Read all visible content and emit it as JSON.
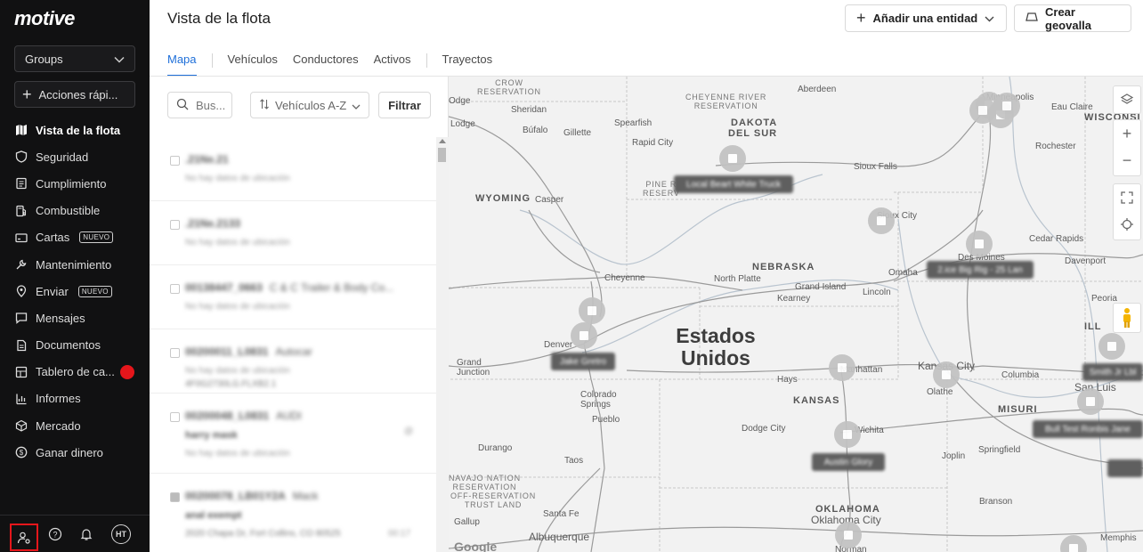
{
  "sidebar": {
    "logo": "motive",
    "groups_label": "Groups",
    "quick_actions_label": "Acciones rápi...",
    "items": [
      {
        "label": "Vista de la flota",
        "icon": "map-icon",
        "active": true
      },
      {
        "label": "Seguridad",
        "icon": "shield-icon"
      },
      {
        "label": "Cumplimiento",
        "icon": "clipboard-icon"
      },
      {
        "label": "Combustible",
        "icon": "fuel-icon"
      },
      {
        "label": "Cartas",
        "icon": "card-icon",
        "badge": "NUEVO"
      },
      {
        "label": "Mantenimiento",
        "icon": "wrench-icon"
      },
      {
        "label": "Enviar",
        "icon": "location-pin-icon",
        "badge": "NUEVO"
      },
      {
        "label": "Mensajes",
        "icon": "chat-icon"
      },
      {
        "label": "Documentos",
        "icon": "document-icon"
      },
      {
        "label": "Tablero de ca...",
        "icon": "dashboard-icon",
        "dot": "#e5161b"
      },
      {
        "label": "Informes",
        "icon": "chart-icon"
      },
      {
        "label": "Mercado",
        "icon": "box-icon"
      },
      {
        "label": "Ganar dinero",
        "icon": "dollar-icon"
      }
    ],
    "footer": {
      "avatar_initials": "HT"
    }
  },
  "header": {
    "title": "Vista de la flota",
    "add_entity_label": "Añadir una entidad",
    "create_geofence_label": "Crear geovalla"
  },
  "tabs": [
    {
      "label": "Mapa",
      "active": true
    },
    {
      "label": "Vehículos"
    },
    {
      "label": "Conductores"
    },
    {
      "label": "Activos"
    },
    {
      "label": "Trayectos"
    }
  ],
  "list": {
    "search_placeholder": "Bus...",
    "sort_label": "Vehículos A-Z",
    "filter_label": "Filtrar",
    "rows": [
      {
        "title": ".21Ne.21",
        "subtitle": "",
        "status": "No hay datos de ubicación",
        "extra": "",
        "meta": ""
      },
      {
        "title": ".21Ne.2133",
        "subtitle": "",
        "status": "No hay datos de ubicación",
        "extra": "",
        "meta": ""
      },
      {
        "title": "00138447_0663",
        "subtitle": "C & C Trailer & Body Co...",
        "status": "No hay datos de ubicación",
        "extra": "",
        "meta": ""
      },
      {
        "title": "00200011_L0831",
        "subtitle": "Autocar",
        "status": "No hay datos de ubicación",
        "extra": "4F0G2730LG.FLXB2.1",
        "meta": ""
      },
      {
        "title": "00200048_L0831",
        "subtitle": "AUDI",
        "status": "harry mask",
        "extra": "No hay datos de ubicación",
        "meta": "@"
      },
      {
        "title": "00200078_LB01Y2A",
        "subtitle": "Mack",
        "status": "anal exempt",
        "extra": "2020 Chapa Dr, Fort Collins, CO 80525",
        "meta": "00:17"
      }
    ]
  },
  "map": {
    "center_label_line1": "Estados",
    "center_label_line2": "Unidos",
    "states": [
      "DAKOTA",
      "DEL SUR",
      "WYOMING",
      "NEBRASKA",
      "KANSAS",
      "MISURI",
      "OKLAHOMA",
      "WISCONSI",
      "ILL"
    ],
    "reservations": [
      {
        "l1": "CROW",
        "l2": "RESERVATION"
      },
      {
        "l1": "CHEYENNE RIVER",
        "l2": "RESERVATION"
      },
      {
        "l1": "PINE R",
        "l2": "RESERV"
      },
      {
        "l1": "NAVAJO NATION",
        "l2": "RESERVATION"
      },
      {
        "l1": "OFF-RESERVATION",
        "l2": "TRUST LAND"
      }
    ],
    "cities": [
      "Aberdeen",
      "Minneapolis",
      "Eau Claire",
      "Sheridan",
      "Spearfish",
      "Búfalo",
      "Gillette",
      "Rapid City",
      "Rochester",
      "Casper",
      "Sioux Falls",
      "Sioux City",
      "Cedar Rapids",
      "Des Moines",
      "Davenport",
      "Cheyenne",
      "North Platte",
      "Grand Island",
      "Kearney",
      "Omaha",
      "Lincoln",
      "Peoria",
      "Grand Junction",
      "Denver",
      "Manhattan",
      "Kansas City",
      "Columbia",
      "Colorado Springs",
      "Pueblo",
      "Hays",
      "Olathe",
      "San Luis",
      "Dodge City",
      "Wichita",
      "Springfield",
      "Joplin",
      "Durango",
      "Taos",
      "Branson",
      "Gallup",
      "Santa Fe",
      "Albuquerque",
      "Oklahoma City",
      "Norman",
      "Memphis",
      "Odge",
      "Lodge"
    ],
    "tags": [
      "Local Beart White Truck",
      "2.ice Big Rig - 25 Lan",
      "Jake Gretro",
      "Smith Jr Lbl",
      "Austin Glory",
      "Bull Test Ronbis Jane"
    ],
    "attribution": "Google"
  }
}
